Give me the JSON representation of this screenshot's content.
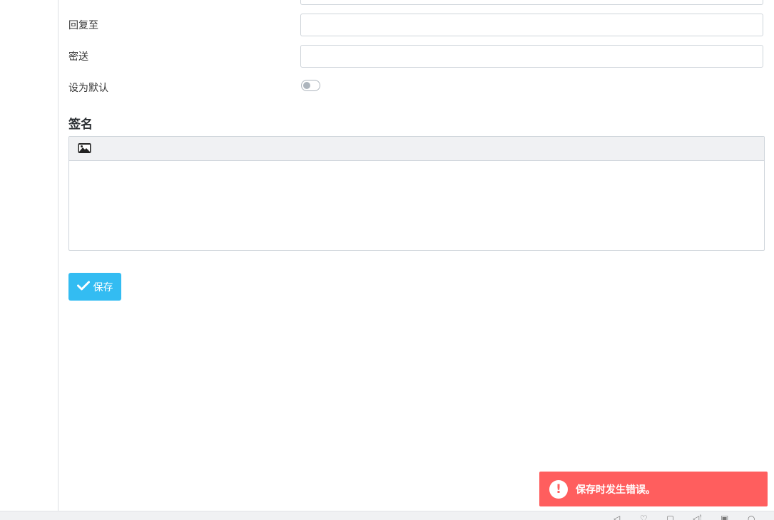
{
  "form": {
    "reply_to_label": "回复至",
    "bcc_label": "密送",
    "set_default_label": "设为默认",
    "set_default_value": false
  },
  "signature": {
    "title": "签名",
    "toolbar_icons": [
      "image-icon"
    ]
  },
  "save_button": {
    "label": "保存",
    "icon": "check-icon"
  },
  "toast": {
    "message": "保存时发生错误。",
    "type": "error",
    "icon": "exclamation-icon"
  },
  "colors": {
    "primary": "#33bcf2",
    "error": "#ff5e5e"
  },
  "status_bar_icons": [
    "send-icon",
    "heart-icon",
    "trash-icon",
    "volume-icon",
    "copy-icon",
    "search-icon"
  ]
}
